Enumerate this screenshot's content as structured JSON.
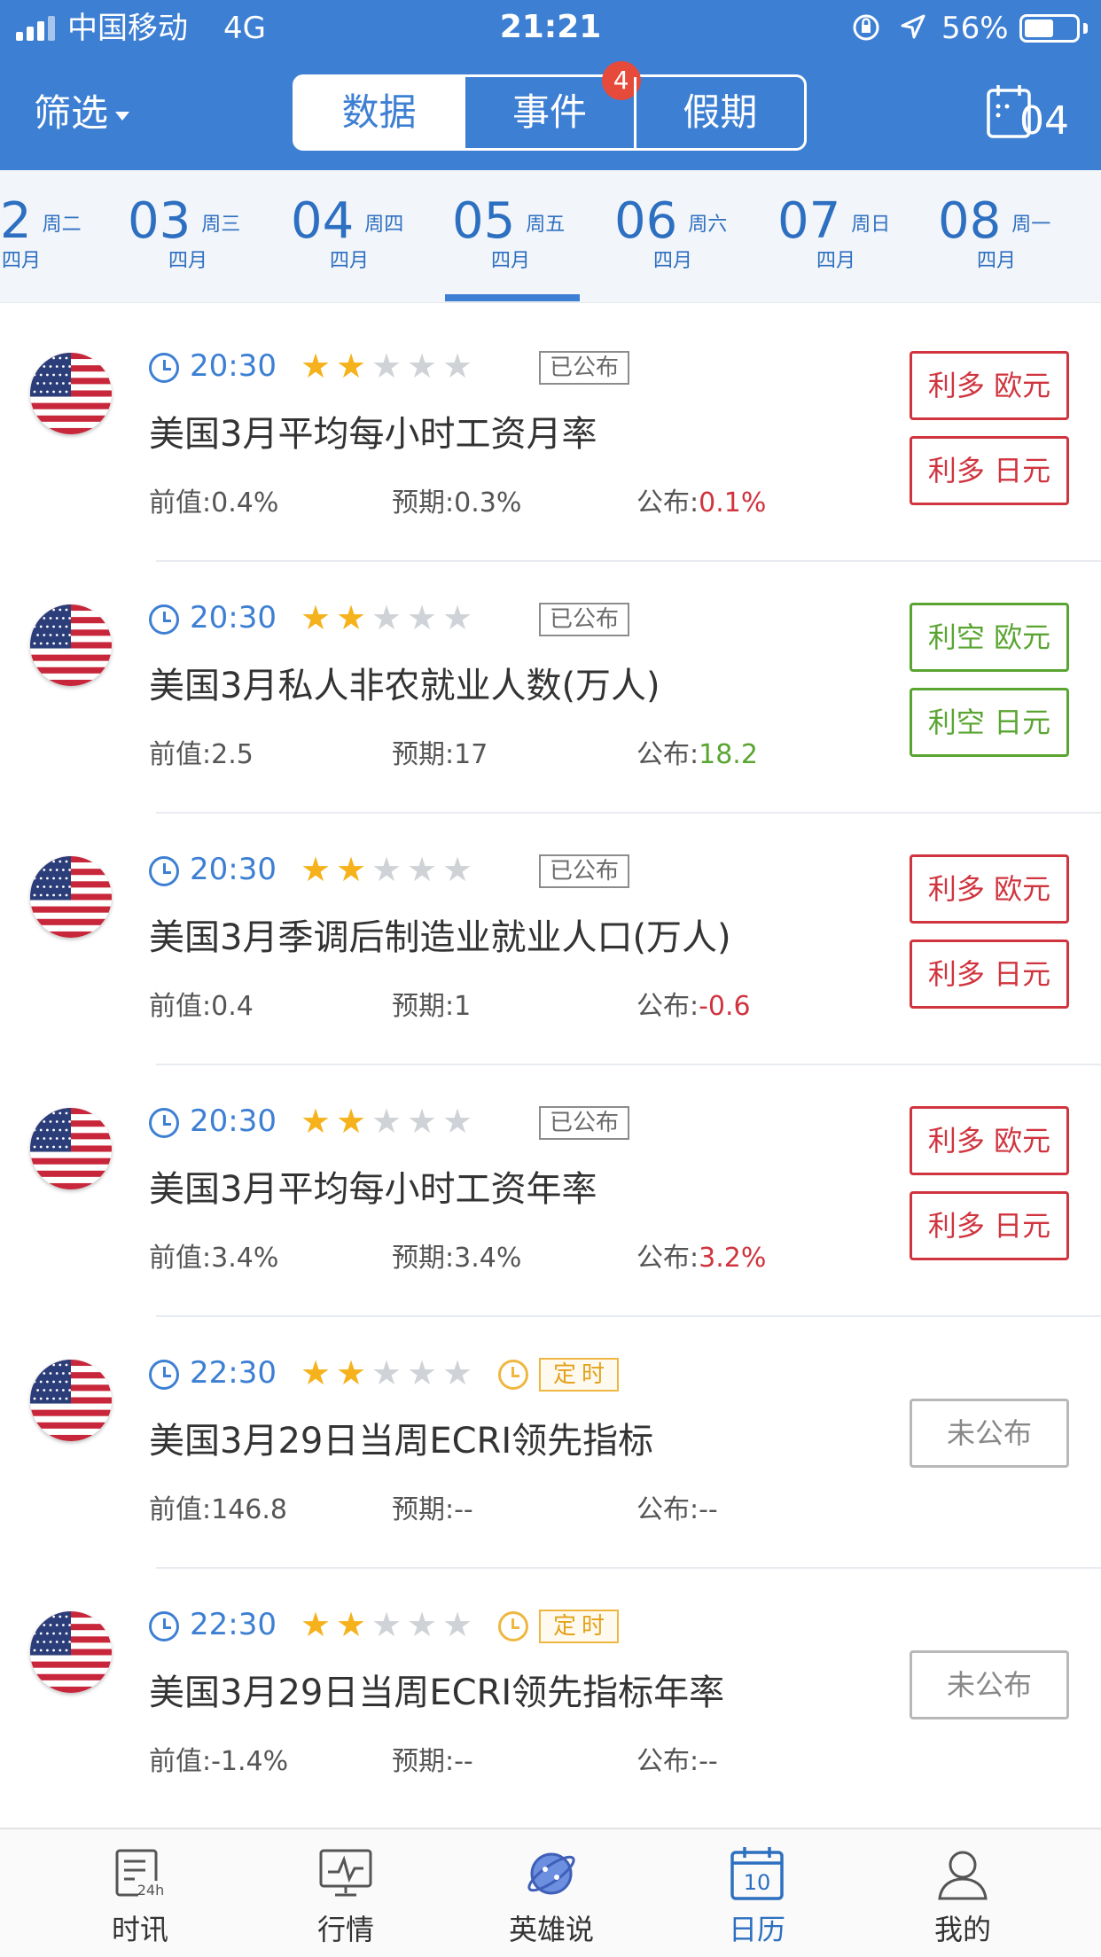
{
  "status_bar": {
    "carrier": "中国移动",
    "network": "4G",
    "time": "21:21",
    "battery": "56%",
    "battery_level": 0.56
  },
  "header": {
    "filter_label": "筛选",
    "tabs": [
      {
        "label": "数据",
        "active": true
      },
      {
        "label": "事件",
        "badge": "4"
      },
      {
        "label": "假期"
      }
    ],
    "calendar_day": "04"
  },
  "dates": [
    {
      "day": "2",
      "weekday": "周二",
      "month": "四月"
    },
    {
      "day": "03",
      "weekday": "周三",
      "month": "四月"
    },
    {
      "day": "04",
      "weekday": "周四",
      "month": "四月"
    },
    {
      "day": "05",
      "weekday": "周五",
      "month": "四月",
      "selected": true
    },
    {
      "day": "06",
      "weekday": "周六",
      "month": "四月"
    },
    {
      "day": "07",
      "weekday": "周日",
      "month": "四月"
    },
    {
      "day": "08",
      "weekday": "周一",
      "month": "四月"
    }
  ],
  "events": [
    {
      "time": "20:30",
      "stars": 2,
      "tag": "已公布",
      "title": "美国3月平均每小时工资月率",
      "prev": "前值:0.4%",
      "forecast": "预期:0.3%",
      "actual_label": "公布:",
      "actual": "0.1%",
      "buttons": [
        "利多 欧元",
        "利多 日元"
      ]
    },
    {
      "time": "20:30",
      "stars": 2,
      "tag": "已公布",
      "title": "美国3月私人非农就业人数(万人)",
      "prev": "前值:2.5",
      "forecast": "预期:17",
      "actual_label": "公布:",
      "actual": "18.2",
      "buttons": [
        "利空 欧元",
        "利空 日元"
      ]
    },
    {
      "time": "20:30",
      "stars": 2,
      "tag": "已公布",
      "title": "美国3月季调后制造业就业人口(万人)",
      "prev": "前值:0.4",
      "forecast": "预期:1",
      "actual_label": "公布:",
      "actual": "-0.6",
      "buttons": [
        "利多 欧元",
        "利多 日元"
      ]
    },
    {
      "time": "20:30",
      "stars": 2,
      "tag": "已公布",
      "title": "美国3月平均每小时工资年率",
      "prev": "前值:3.4%",
      "forecast": "预期:3.4%",
      "actual_label": "公布:",
      "actual": "3.2%",
      "buttons": [
        "利多 欧元",
        "利多 日元"
      ]
    },
    {
      "time": "22:30",
      "stars": 2,
      "tag": "定时",
      "title": "美国3月29日当周ECRI领先指标",
      "prev": "前值:146.8",
      "forecast": "预期:--",
      "actual_label": "公布:",
      "actual": "--",
      "pending": "未公布"
    },
    {
      "time": "22:30",
      "stars": 2,
      "tag": "定时",
      "title": "美国3月29日当周ECRI领先指标年率",
      "prev": "前值:-1.4%",
      "forecast": "预期:--",
      "actual_label": "公布:",
      "actual": "--",
      "pending": "未公布"
    }
  ],
  "bottom_nav": [
    {
      "label": "时讯",
      "icon": "news-24h-icon"
    },
    {
      "label": "行情",
      "icon": "market-chart-icon"
    },
    {
      "label": "英雄说",
      "icon": "planet-icon"
    },
    {
      "label": "日历",
      "icon": "calendar-icon",
      "active": true,
      "icon_text": "10"
    },
    {
      "label": "我的",
      "icon": "person-icon"
    }
  ],
  "colors": {
    "brand_blue": "#3d7fd3",
    "bullish_red": "#d0343f",
    "bearish_green": "#5aa532",
    "scheduled_orange": "#e3a21a"
  }
}
